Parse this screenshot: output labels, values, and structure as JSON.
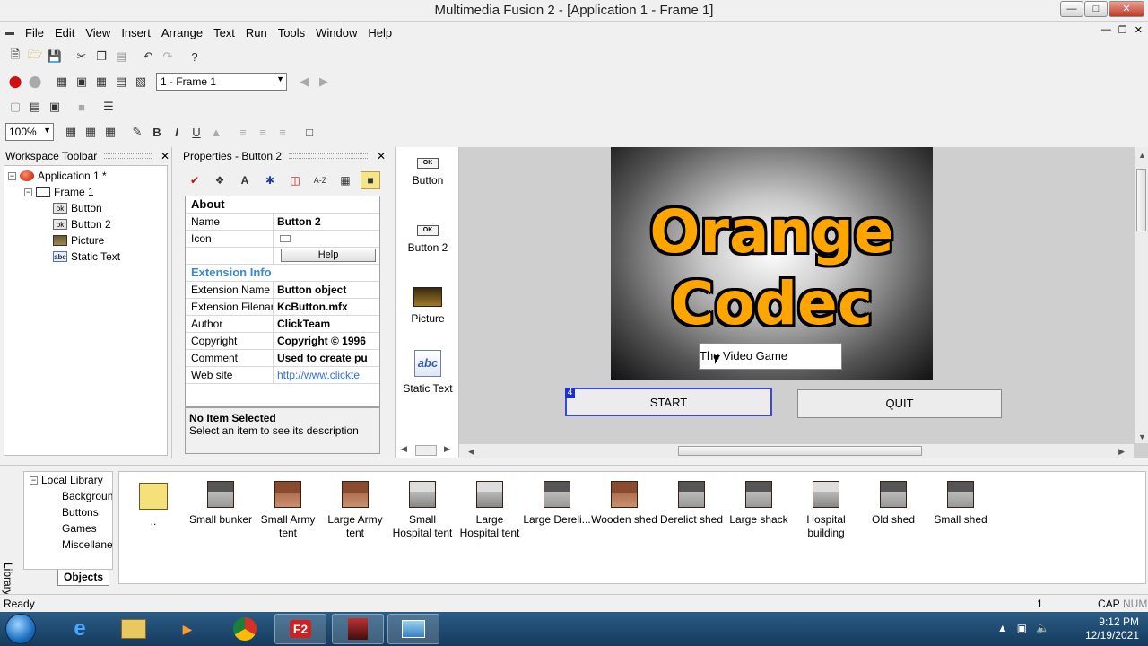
{
  "window": {
    "title": "Multimedia Fusion 2 - [Application 1 - Frame 1]"
  },
  "menu": [
    "File",
    "Edit",
    "View",
    "Insert",
    "Arrange",
    "Text",
    "Run",
    "Tools",
    "Window",
    "Help"
  ],
  "toolbar": {
    "frame_select": "1 - Frame 1",
    "zoom": "100%"
  },
  "workspace": {
    "title": "Workspace Toolbar",
    "tree": [
      {
        "label": "Application 1 *",
        "icon": "app-icon"
      },
      {
        "label": "Frame 1",
        "icon": "frame-icon"
      },
      {
        "label": "Button",
        "icon": "button-object-icon"
      },
      {
        "label": "Button 2",
        "icon": "button-object-icon"
      },
      {
        "label": "Picture",
        "icon": "picture-object-icon"
      },
      {
        "label": "Static Text",
        "icon": "static-text-icon"
      }
    ]
  },
  "properties": {
    "title": "Properties - Button 2",
    "about": "About",
    "name_label": "Name",
    "name_value": "Button 2",
    "icon_label": "Icon",
    "help_button": "Help",
    "ext_section": "Extension Info",
    "ext_name_label": "Extension Name",
    "ext_name_value": "Button object",
    "ext_file_label": "Extension Filenar",
    "ext_file_value": "KcButton.mfx",
    "author_label": "Author",
    "author_value": "ClickTeam",
    "copyright_label": "Copyright",
    "copyright_value": "Copyright © 1996",
    "comment_label": "Comment",
    "comment_value": "Used to create pu",
    "website_label": "Web site",
    "website_value": "http://www.clickte",
    "desc_title": "No Item Selected",
    "desc_text": "Select an item to see its description"
  },
  "object_bar": [
    {
      "label": "Button",
      "ok": "OK"
    },
    {
      "label": "Button 2",
      "ok": "OK"
    },
    {
      "label": "Picture"
    },
    {
      "label": "Static Text",
      "abc": "abc"
    }
  ],
  "frame": {
    "title_line1": "Orange",
    "title_line2": "Codec",
    "static_text": "The Video Game",
    "start_button": "START",
    "start_tag": "4",
    "quit_button": "QUIT"
  },
  "library": {
    "vertical_label": "Library Toolbar",
    "tree_root": "Local Library",
    "tree_items": [
      "Backgrounds",
      "Buttons",
      "Games",
      "Miscellaneous"
    ],
    "tab": "Objects",
    "objects": [
      {
        "label": ".."
      },
      {
        "label": "Small bunker"
      },
      {
        "label": "Small Army tent"
      },
      {
        "label": "Large Army tent"
      },
      {
        "label": "Small Hospital tent"
      },
      {
        "label": "Large Hospital tent"
      },
      {
        "label": "Large Dereli..."
      },
      {
        "label": "Wooden shed"
      },
      {
        "label": "Derelict shed"
      },
      {
        "label": "Large shack"
      },
      {
        "label": "Hospital building"
      },
      {
        "label": "Old shed"
      },
      {
        "label": "Small shed"
      }
    ]
  },
  "status": {
    "left": "Ready",
    "count": "1",
    "cap": "CAP",
    "num": "NUM"
  },
  "taskbar": {
    "time": "9:12 PM",
    "date": "12/19/2021",
    "f2": "F2"
  }
}
